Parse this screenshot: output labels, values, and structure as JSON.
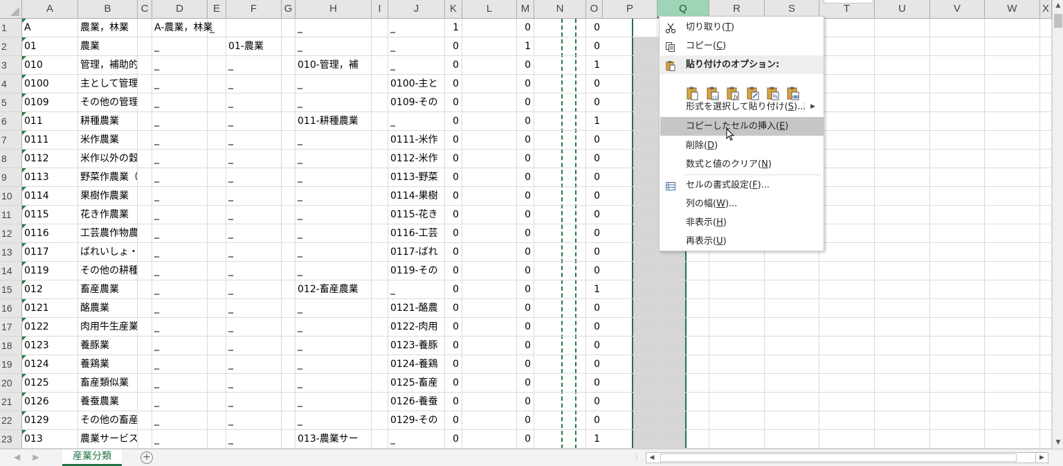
{
  "columns": [
    {
      "name": "A"
    },
    {
      "name": "B"
    },
    {
      "name": "C"
    },
    {
      "name": "D"
    },
    {
      "name": "E"
    },
    {
      "name": "F"
    },
    {
      "name": "G"
    },
    {
      "name": "H"
    },
    {
      "name": "I"
    },
    {
      "name": "J"
    },
    {
      "name": "K"
    },
    {
      "name": "L"
    },
    {
      "name": "M"
    },
    {
      "name": "N"
    },
    {
      "name": "O"
    },
    {
      "name": "P"
    },
    {
      "name": "Q"
    },
    {
      "name": "R"
    },
    {
      "name": "S"
    },
    {
      "name": "T"
    },
    {
      "name": "U"
    },
    {
      "name": "V"
    },
    {
      "name": "W"
    },
    {
      "name": "X"
    }
  ],
  "selected_column": "Q",
  "rows": [
    {
      "n": "1",
      "A": "A",
      "B": "農業，林業",
      "D": "A-農業，林業",
      "E": "_",
      "F": "",
      "H": "_",
      "J": "_",
      "K": "1",
      "M": "0",
      "O": "0"
    },
    {
      "n": "2",
      "A": "01",
      "B": "農業",
      "D": "_",
      "E": "",
      "F": "01-農業",
      "H": "_",
      "J": "_",
      "K": "0",
      "M": "1",
      "O": "0"
    },
    {
      "n": "3",
      "A": "010",
      "B": "管理，補助的",
      "D": "_",
      "E": "",
      "F": "_",
      "H": "010-管理，補",
      "J": "_",
      "K": "0",
      "M": "0",
      "O": "1"
    },
    {
      "n": "4",
      "A": "0100",
      "B": "主として管理",
      "D": "_",
      "E": "",
      "F": "_",
      "H": "_",
      "J": "0100-主と",
      "K": "0",
      "M": "0",
      "O": "0"
    },
    {
      "n": "5",
      "A": "0109",
      "B": "その他の管理,",
      "D": "_",
      "E": "",
      "F": "_",
      "H": "_",
      "J": "0109-その",
      "K": "0",
      "M": "0",
      "O": "0"
    },
    {
      "n": "6",
      "A": "011",
      "B": "耕種農業",
      "D": "_",
      "E": "",
      "F": "_",
      "H": "011-耕種農業",
      "J": "_",
      "K": "0",
      "M": "0",
      "O": "1"
    },
    {
      "n": "7",
      "A": "0111",
      "B": "米作農業",
      "D": "_",
      "E": "",
      "F": "_",
      "H": "_",
      "J": "0111-米作",
      "K": "0",
      "M": "0",
      "O": "0"
    },
    {
      "n": "8",
      "A": "0112",
      "B": "米作以外の穀",
      "D": "_",
      "E": "",
      "F": "_",
      "H": "_",
      "J": "0112-米作",
      "K": "0",
      "M": "0",
      "O": "0"
    },
    {
      "n": "9",
      "A": "0113",
      "B": "野菜作農業（",
      "D": "_",
      "E": "",
      "F": "_",
      "H": "_",
      "J": "0113-野菜",
      "K": "0",
      "M": "0",
      "O": "0"
    },
    {
      "n": "10",
      "A": "0114",
      "B": "果樹作農業",
      "D": "_",
      "E": "",
      "F": "_",
      "H": "_",
      "J": "0114-果樹",
      "K": "0",
      "M": "0",
      "O": "0"
    },
    {
      "n": "11",
      "A": "0115",
      "B": "花き作農業",
      "D": "_",
      "E": "",
      "F": "_",
      "H": "_",
      "J": "0115-花き",
      "K": "0",
      "M": "0",
      "O": "0"
    },
    {
      "n": "12",
      "A": "0116",
      "B": "工芸農作物農",
      "D": "_",
      "E": "",
      "F": "_",
      "H": "_",
      "J": "0116-工芸",
      "K": "0",
      "M": "0",
      "O": "0"
    },
    {
      "n": "13",
      "A": "0117",
      "B": "ばれいしょ・",
      "D": "_",
      "E": "",
      "F": "_",
      "H": "_",
      "J": "0117-ばれ",
      "K": "0",
      "M": "0",
      "O": "0"
    },
    {
      "n": "14",
      "A": "0119",
      "B": "その他の耕種",
      "D": "_",
      "E": "",
      "F": "_",
      "H": "_",
      "J": "0119-その",
      "K": "0",
      "M": "0",
      "O": "0"
    },
    {
      "n": "15",
      "A": "012",
      "B": "畜産農業",
      "D": "_",
      "E": "",
      "F": "_",
      "H": "012-畜産農業",
      "J": "_",
      "K": "0",
      "M": "0",
      "O": "1"
    },
    {
      "n": "16",
      "A": "0121",
      "B": "酪農業",
      "D": "_",
      "E": "",
      "F": "_",
      "H": "_",
      "J": "0121-酪農",
      "K": "0",
      "M": "0",
      "O": "0"
    },
    {
      "n": "17",
      "A": "0122",
      "B": "肉用牛生産業",
      "D": "_",
      "E": "",
      "F": "_",
      "H": "_",
      "J": "0122-肉用",
      "K": "0",
      "M": "0",
      "O": "0"
    },
    {
      "n": "18",
      "A": "0123",
      "B": "養豚業",
      "D": "_",
      "E": "",
      "F": "_",
      "H": "_",
      "J": "0123-養豚",
      "K": "0",
      "M": "0",
      "O": "0"
    },
    {
      "n": "19",
      "A": "0124",
      "B": "養鶏業",
      "D": "_",
      "E": "",
      "F": "_",
      "H": "_",
      "J": "0124-養鶏",
      "K": "0",
      "M": "0",
      "O": "0"
    },
    {
      "n": "20",
      "A": "0125",
      "B": "畜産類似業",
      "D": "_",
      "E": "",
      "F": "_",
      "H": "_",
      "J": "0125-畜産",
      "K": "0",
      "M": "0",
      "O": "0"
    },
    {
      "n": "21",
      "A": "0126",
      "B": "養蚕農業",
      "D": "_",
      "E": "",
      "F": "_",
      "H": "_",
      "J": "0126-養蚕",
      "K": "0",
      "M": "0",
      "O": "0"
    },
    {
      "n": "22",
      "A": "0129",
      "B": "その他の畜産",
      "D": "_",
      "E": "",
      "F": "_",
      "H": "_",
      "J": "0129-その",
      "K": "0",
      "M": "0",
      "O": "0"
    },
    {
      "n": "23",
      "A": "013",
      "B": "農業サービス",
      "D": "_",
      "E": "",
      "F": "_",
      "H": "013-農業サー",
      "J": "_",
      "K": "0",
      "M": "0",
      "O": "1"
    }
  ],
  "context_menu": {
    "cut": {
      "label": "切り取り(",
      "key": "T",
      "end": ")",
      "icon": "scissors-icon"
    },
    "copy": {
      "label": "コピー(",
      "key": "C",
      "end": ")",
      "icon": "copy-icon"
    },
    "paste_options_header": "貼り付けのオプション:",
    "paste_icons": [
      "paste-icon",
      "paste-values-icon",
      "paste-formulas-icon",
      "paste-transpose-icon",
      "paste-formatting-icon",
      "paste-link-icon"
    ],
    "paste_special": {
      "label": "形式を選択して貼り付け(",
      "key": "S",
      "end": ")..."
    },
    "insert_copied": {
      "label": "コピーしたセルの挿入(",
      "key": "E",
      "end": ")"
    },
    "delete": {
      "label": "削除(",
      "key": "D",
      "end": ")"
    },
    "clear": {
      "label": "数式と値のクリア(",
      "key": "N",
      "end": ")"
    },
    "format_cells": {
      "label": "セルの書式設定(",
      "key": "F",
      "end": ")...",
      "icon": "format-cells-icon"
    },
    "column_width": {
      "label": "列の幅(",
      "key": "W",
      "end": ")..."
    },
    "hide": {
      "label": "非表示(",
      "key": "H",
      "end": ")"
    },
    "unhide": {
      "label": "再表示(",
      "key": "U",
      "end": ")"
    }
  },
  "sheet_tab": "産業分類",
  "colors": {
    "accent": "#217346",
    "selected_col_bg": "#d6d6d6",
    "menu_highlight": "#c6c6c6"
  }
}
